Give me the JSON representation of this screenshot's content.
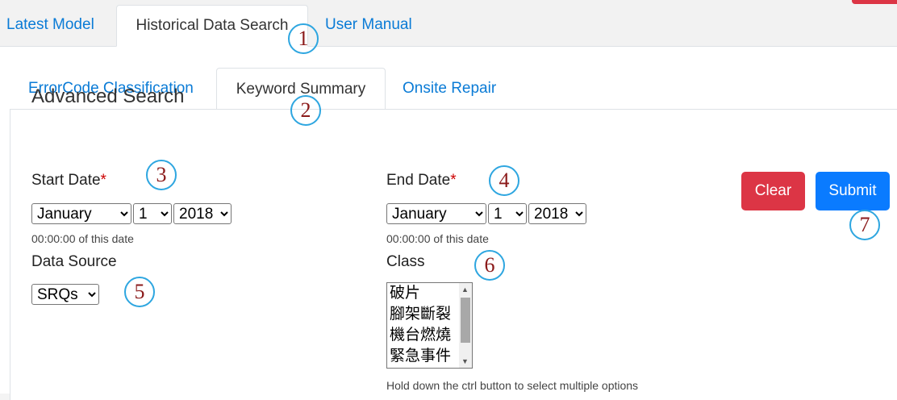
{
  "top_tabs": [
    {
      "label": "Latest Model",
      "active": false
    },
    {
      "label": "Historical Data Search",
      "active": true
    },
    {
      "label": "User Manual",
      "active": false
    }
  ],
  "sub_tabs": [
    {
      "label": "ErrorCode Classification",
      "active": false
    },
    {
      "label": "Keyword Summary",
      "active": true
    },
    {
      "label": "Onsite Repair",
      "active": false
    }
  ],
  "form": {
    "title": "Advanced Search",
    "start_date": {
      "label": "Start Date",
      "required_mark": "*",
      "month": "January",
      "day": "1",
      "year": "2018",
      "hint": "00:00:00 of this date"
    },
    "end_date": {
      "label": "End Date",
      "required_mark": "*",
      "month": "January",
      "day": "1",
      "year": "2018",
      "hint": "00:00:00 of this date"
    },
    "data_source": {
      "label": "Data Source",
      "value": "SRQs"
    },
    "class": {
      "label": "Class",
      "options": [
        "破片",
        "腳架斷裂",
        "機台燃燒",
        "緊急事件"
      ],
      "hint": "Hold down the ctrl button to select multiple options"
    },
    "clear_label": "Clear",
    "submit_label": "Submit"
  },
  "annotations": [
    "1",
    "2",
    "3",
    "4",
    "5",
    "6",
    "7"
  ],
  "colors": {
    "link_blue": "#0a7bd6",
    "clear_red": "#dc3545",
    "submit_blue": "#0a7bff",
    "annotation_border": "#2ea6e0",
    "annotation_text": "#8b1a1a"
  }
}
